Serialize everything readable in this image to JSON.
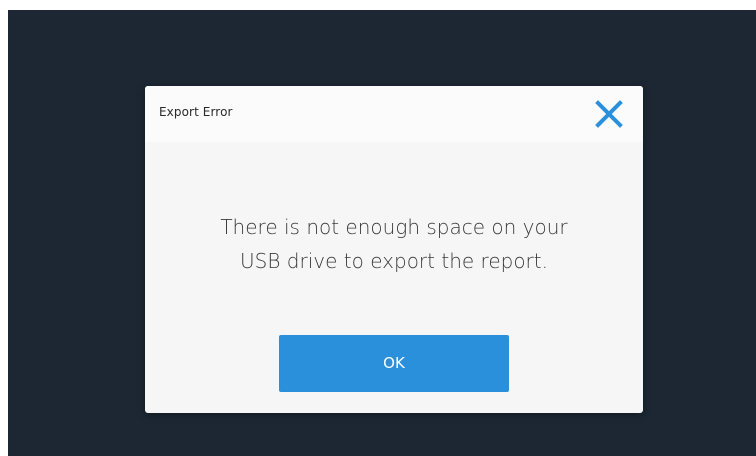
{
  "dialog": {
    "title": "Export Error",
    "close_icon": "close-icon",
    "message_lines": [
      "There is not enough space on your",
      "USB drive to export the report."
    ],
    "ok_label": "OK"
  },
  "colors": {
    "screen_background": "#1c2733",
    "dialog_background": "#f6f6f6",
    "accent": "#2b90dc",
    "close_icon": "#2b90dc"
  }
}
